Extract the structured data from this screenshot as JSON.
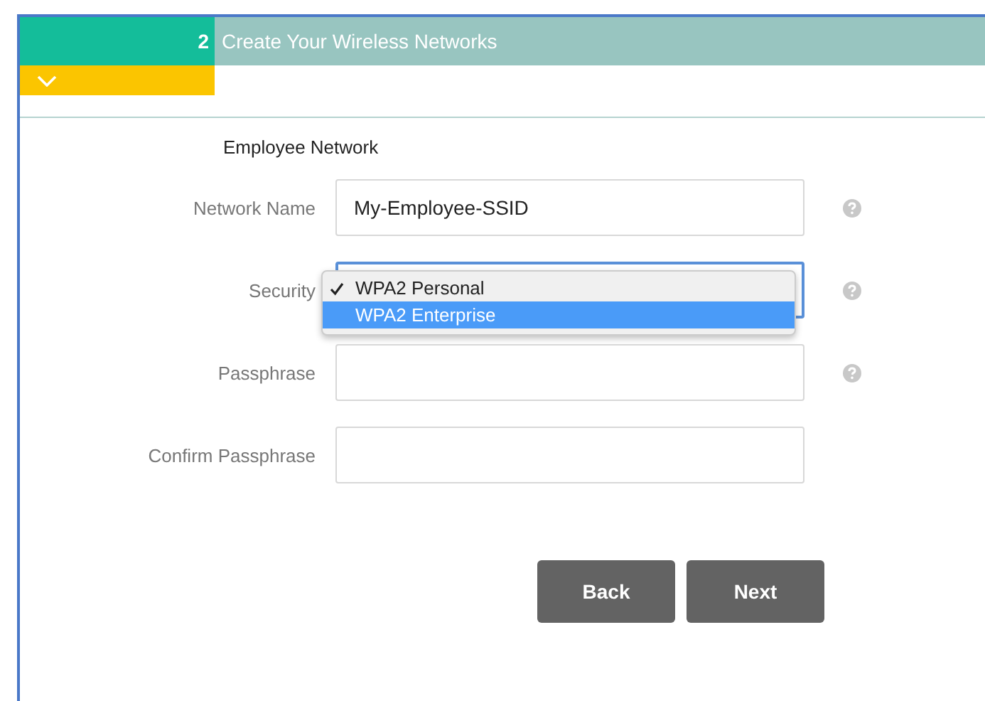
{
  "step": {
    "number": "2",
    "title": "Create Your Wireless Networks",
    "expanded": true
  },
  "section_title": "Employee Network",
  "fields": [
    {
      "kind": "text",
      "label": "Network Name",
      "value": "My-Employee-SSID",
      "help": true
    },
    {
      "kind": "select",
      "label": "Security",
      "help": true,
      "focused": true,
      "dropdown": [
        {
          "label": "WPA2 Personal",
          "checked": true,
          "selected": false
        },
        {
          "label": "WPA2 Enterprise",
          "checked": false,
          "selected": true
        }
      ]
    },
    {
      "kind": "password",
      "label": "Passphrase",
      "help": true
    },
    {
      "kind": "password",
      "label": "Confirm Passphrase",
      "help": false
    }
  ],
  "buttons": [
    "Back",
    "Next"
  ]
}
